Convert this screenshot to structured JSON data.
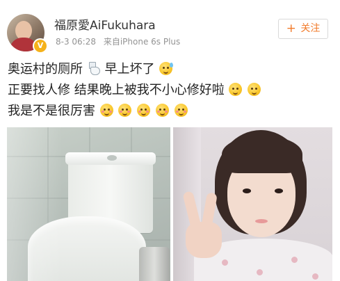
{
  "post": {
    "author_name": "福原愛AiFukuhara",
    "timestamp": "8-3 06:28",
    "source": "来自iPhone 6s Plus",
    "follow_button": {
      "plus": "+",
      "label": "关注"
    },
    "verified_badge": "V",
    "text_lines": [
      "奥运村的厕所",
      "早上坏了",
      "正要找人修 结果晚上被我不小心修好啦",
      "我是不是很厉害"
    ],
    "emoji_names": [
      "toilet-icon",
      "sweat-smile-emoji",
      "blush-emoji",
      "blush-emoji",
      "blush-emoji"
    ]
  },
  "photos": [
    {
      "subject": "toilet"
    },
    {
      "subject": "selfie-peace-sign"
    }
  ]
}
